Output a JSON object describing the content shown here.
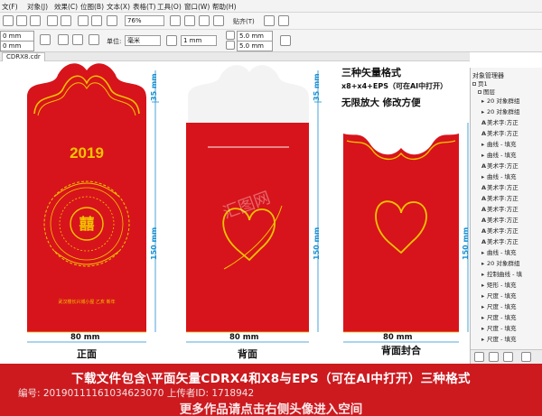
{
  "menu": [
    "文(F)",
    "对象(J)",
    "效果(C)",
    "位图(B)",
    "文本(X)",
    "表格(T)",
    "工具(O)",
    "窗口(W)",
    "帮助(H)"
  ],
  "toolbar": {
    "zoom": "76%",
    "snap_label": "贴齐(T)",
    "unit_label": "单位:",
    "unit_value": "毫米",
    "nudge_value": "1 mm",
    "dup_x": "5.0 mm",
    "dup_y": "5.0 mm",
    "pos_x": "0 mm",
    "pos_y": "0 mm"
  },
  "document_tab": "CDRX8.cdr",
  "canvas": {
    "front": {
      "year": "2019",
      "caption": "正面",
      "width": "80 mm",
      "height": "150 mm",
      "top_height": "35 mm",
      "small_text": "武汉楼长兴城小屋 乙亥 新年"
    },
    "back": {
      "caption": "背面",
      "width": "80 mm",
      "height": "150 mm",
      "top_height": "35 mm"
    },
    "back_sealed": {
      "caption": "背面封合",
      "width": "80 mm",
      "height": "150 mm"
    },
    "notes": {
      "line1": "三种矢量格式",
      "line2": "x8+x4+EPS（可在AI中打开）",
      "line3": "无限放大 修改方便"
    },
    "watermark": "汇图网"
  },
  "object_manager": {
    "title": "对象管理器",
    "page": "页1",
    "layer": "图层",
    "items": [
      "20 对象群组",
      "20 对象群组",
      "美术字:方正",
      "美术字:方正",
      "曲线 - 填充",
      "曲线 - 填充",
      "美术字:方正",
      "曲线 - 填充",
      "美术字:方正",
      "美术字:方正",
      "美术字:方正",
      "美术字:方正",
      "美术字:方正",
      "美术字:方正",
      "曲线 - 填充",
      "20 对象群组",
      "控制曲线 - 填",
      "矩形 - 填充",
      "尺度 - 填充",
      "尺度 - 填充",
      "尺度 - 填充",
      "尺度 - 填充",
      "尺度 - 填充"
    ]
  },
  "banner": {
    "line1": "下载文件包含\\平面矢量CDRX4和X8与EPS（可在AI中打开）三种格式",
    "line2": "编号: 20190111161034623070 上传者ID: 1718942",
    "line3": "更多作品请点击右侧头像进入空间"
  },
  "colors": {
    "envelope_red": "#d7141b",
    "gold": "#f3c400",
    "dimension_blue": "#1a8fd0",
    "banner_red": "#cc1a1f"
  }
}
